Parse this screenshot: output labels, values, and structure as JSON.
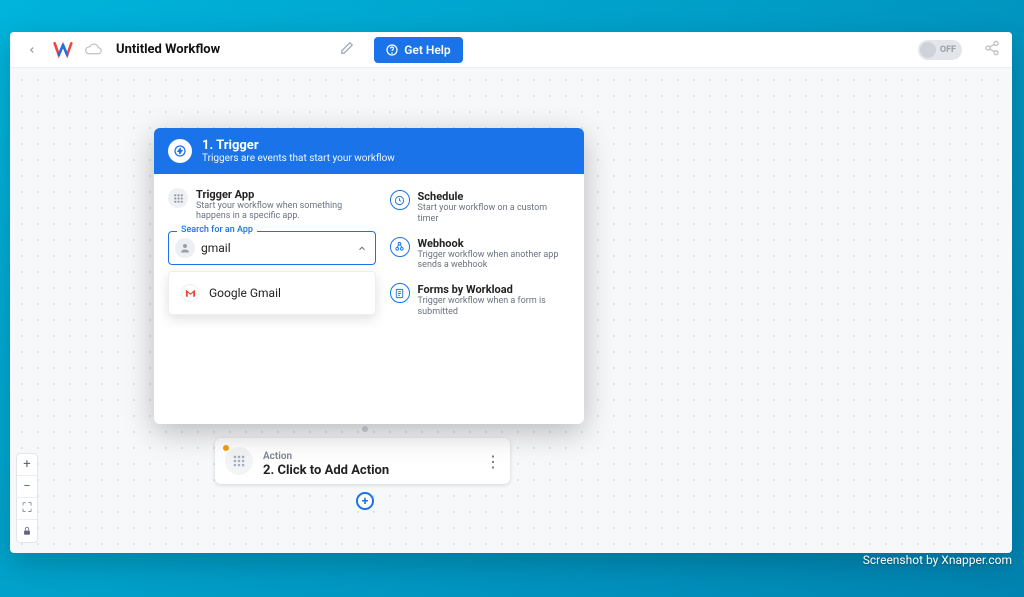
{
  "header": {
    "title": "Untitled Workflow",
    "help_label": "Get Help",
    "toggle_label": "OFF"
  },
  "modal": {
    "step": "1. Trigger",
    "subtitle": "Triggers are events that start your workflow",
    "trigger_app": {
      "title": "Trigger App",
      "desc": "Start your workflow when something happens in a specific app."
    },
    "search": {
      "label": "Search for an App",
      "value": "gmail"
    },
    "dropdown": [
      {
        "label": "Google Gmail"
      }
    ],
    "options": [
      {
        "title": "Schedule",
        "desc": "Start your workflow on a custom timer",
        "icon": "clock"
      },
      {
        "title": "Webhook",
        "desc": "Trigger workflow when another app sends a webhook",
        "icon": "webhook"
      },
      {
        "title": "Forms by Workload",
        "desc": "Trigger workflow when a form is submitted",
        "icon": "form"
      }
    ]
  },
  "action_card": {
    "kicker": "Action",
    "title": "2. Click to Add Action"
  },
  "watermark": "Screenshot by Xnapper.com"
}
